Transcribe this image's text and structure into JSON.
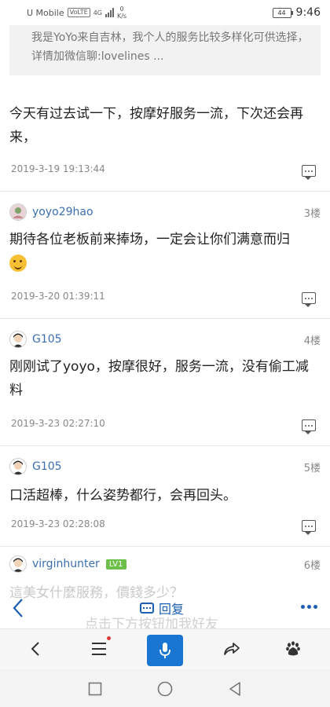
{
  "status": {
    "carrier": "U Mobile",
    "carrier_tag": "VoLTE",
    "net": "4G",
    "speed_value": "0",
    "speed_unit": "K/s",
    "battery": "44",
    "time": "9:46"
  },
  "quote": {
    "text": "我是YoYo来自吉林，我个人的服务比较多样化可供选择，详情加微信聊:lovelines ..."
  },
  "posts": [
    {
      "body": "今天有过去试一下，按摩好服务一流，下次还会再来，",
      "time": "2019-3-19 19:13:44"
    },
    {
      "user": "yoyo29hao",
      "floor": "3楼",
      "body": "期待各位老板前来捧场，一定会让你们满意而归",
      "time": "2019-3-20 01:39:11"
    },
    {
      "user": "G105",
      "floor": "4楼",
      "body": "刚刚试了yoyo，按摩很好，服务一流，没有偷工减料",
      "time": "2019-3-23 02:27:10"
    },
    {
      "user": "G105",
      "floor": "5楼",
      "body": "口活超棒，什么姿势都行，会再回头。",
      "time": "2019-3-23 02:28:08"
    },
    {
      "user": "virginhunter",
      "badge": "LV1",
      "floor": "6楼",
      "body": "這美女什麼服務，價錢多少？"
    }
  ],
  "overlay_hint": "点击下方按钮加我好友",
  "reply_bar": {
    "reply_label": "回复"
  },
  "icons": {
    "back": "chevron-left-icon",
    "menu": "hamburger-menu-icon",
    "mic": "microphone-icon",
    "share": "share-icon",
    "baidu": "baidu-paw-icon"
  },
  "colors": {
    "link_blue": "#3b6fb0",
    "accent_blue": "#1976d2",
    "badge_green": "#6cc04a"
  }
}
